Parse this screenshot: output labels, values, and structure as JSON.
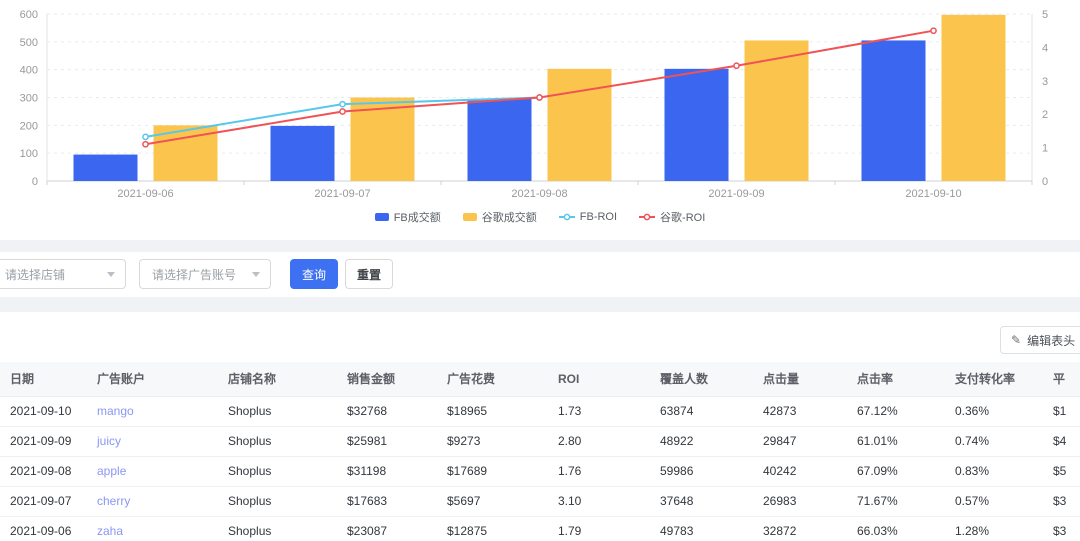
{
  "chart_data": {
    "type": "bar",
    "subtype": "combo-bar-line-dual-axis",
    "categories": [
      "2021-09-06",
      "2021-09-07",
      "2021-09-08",
      "2021-09-09",
      "2021-09-10"
    ],
    "series": [
      {
        "name": "FB成交额",
        "kind": "bar",
        "axis": "left",
        "color": "#3a66f0",
        "values": [
          95,
          198,
          295,
          403,
          505
        ]
      },
      {
        "name": "谷歌成交额",
        "kind": "bar",
        "axis": "left",
        "color": "#fbc54d",
        "values": [
          200,
          300,
          403,
          505,
          597
        ]
      },
      {
        "name": "FB-ROI",
        "kind": "line",
        "axis": "right",
        "color": "#57c7eb",
        "values": [
          1.32,
          2.3,
          2.5,
          null,
          null
        ]
      },
      {
        "name": "谷歌-ROI",
        "kind": "line",
        "axis": "right",
        "color": "#f05355",
        "values": [
          1.1,
          2.08,
          2.5,
          3.45,
          4.5
        ]
      }
    ],
    "left_axis": {
      "min": 0,
      "max": 600,
      "step": 100,
      "ticks": [
        "0",
        "100",
        "200",
        "300",
        "400",
        "500",
        "600"
      ]
    },
    "right_axis": {
      "min": 0,
      "max": 5,
      "step": 1,
      "ticks": [
        "0",
        "1",
        "2",
        "3",
        "4",
        "5"
      ]
    },
    "grid": true,
    "legend_position": "bottom"
  },
  "filters": {
    "shop_placeholder": "请选择店铺",
    "account_placeholder": "请选择广告账号",
    "query_label": "查询",
    "reset_label": "重置"
  },
  "table": {
    "edit_button_label": "编辑表头",
    "headers": [
      "日期",
      "广告账户",
      "店铺名称",
      "销售金额",
      "广告花费",
      "ROI",
      "覆盖人数",
      "点击量",
      "点击率",
      "支付转化率",
      "平"
    ],
    "rows": [
      [
        "2021-09-10",
        "mango",
        "Shoplus",
        "$32768",
        "$18965",
        "1.73",
        "63874",
        "42873",
        "67.12%",
        "0.36%",
        "$1"
      ],
      [
        "2021-09-09",
        "juicy",
        "Shoplus",
        "$25981",
        "$9273",
        "2.80",
        "48922",
        "29847",
        "61.01%",
        "0.74%",
        "$4"
      ],
      [
        "2021-09-08",
        "apple",
        "Shoplus",
        "$31198",
        "$17689",
        "1.76",
        "59986",
        "40242",
        "67.09%",
        "0.83%",
        "$5"
      ],
      [
        "2021-09-07",
        "cherry",
        "Shoplus",
        "$17683",
        "$5697",
        "3.10",
        "37648",
        "26983",
        "71.67%",
        "0.57%",
        "$3"
      ],
      [
        "2021-09-06",
        "zaha",
        "Shoplus",
        "$23087",
        "$12875",
        "1.79",
        "49783",
        "32872",
        "66.03%",
        "1.28%",
        "$3"
      ]
    ]
  },
  "colors": {
    "primary_button": "#3e70f2",
    "link": "#8a97f4",
    "band": "#f0f2f5",
    "axis_label": "#999999",
    "gridline": "#e7eaf2"
  }
}
